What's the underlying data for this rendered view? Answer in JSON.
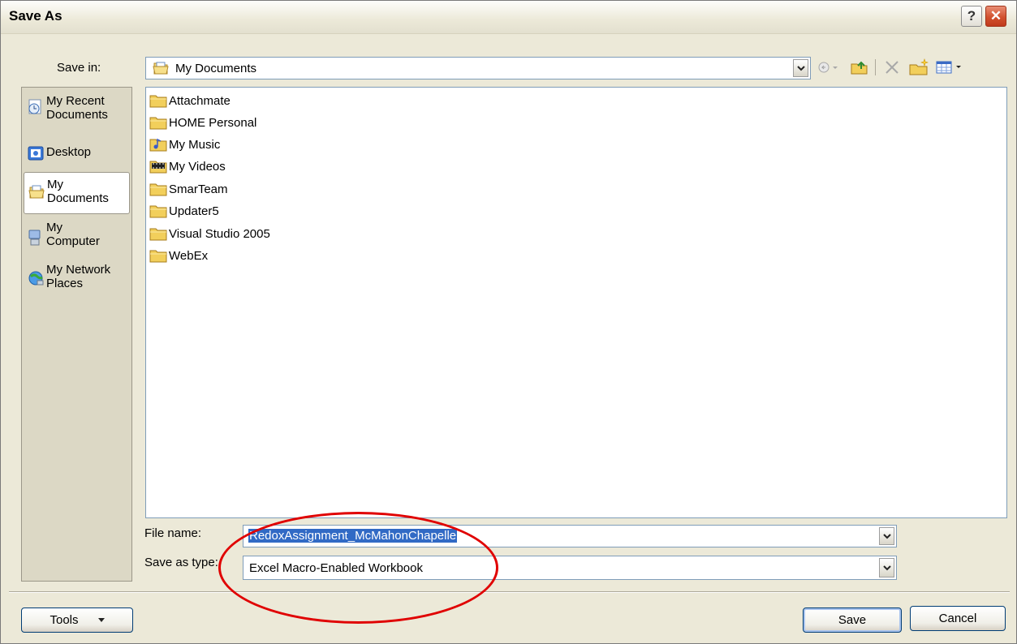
{
  "window": {
    "title": "Save As",
    "help_label": "?",
    "close_label": "✕"
  },
  "save_in": {
    "label": "Save in:",
    "value": "My Documents",
    "toolbar_icons": [
      "back-icon",
      "up-folder-icon",
      "delete-icon",
      "new-folder-icon",
      "views-icon"
    ]
  },
  "places": [
    {
      "label": "My Recent\nDocuments",
      "icon": "recent-documents-icon"
    },
    {
      "label": "Desktop",
      "icon": "desktop-icon"
    },
    {
      "label": "My\nDocuments",
      "icon": "my-documents-icon",
      "selected": true
    },
    {
      "label": "My\nComputer",
      "icon": "my-computer-icon"
    },
    {
      "label": "My Network\nPlaces",
      "icon": "network-places-icon"
    }
  ],
  "files": [
    {
      "name": "Attachmate",
      "icon": "folder-icon"
    },
    {
      "name": "HOME Personal",
      "icon": "folder-icon"
    },
    {
      "name": "My Music",
      "icon": "music-folder-icon"
    },
    {
      "name": "My Videos",
      "icon": "video-folder-icon"
    },
    {
      "name": "SmarTeam",
      "icon": "folder-icon"
    },
    {
      "name": "Updater5",
      "icon": "folder-icon"
    },
    {
      "name": "Visual Studio 2005",
      "icon": "folder-icon"
    },
    {
      "name": "WebEx",
      "icon": "folder-icon"
    }
  ],
  "file_name": {
    "label": "File name:",
    "value": "RedoxAssignment_McMahonChapelle"
  },
  "save_as_type": {
    "label": "Save as type:",
    "value": "Excel Macro-Enabled Workbook"
  },
  "buttons": {
    "tools": "Tools",
    "save": "Save",
    "cancel": "Cancel"
  },
  "colors": {
    "annotation": "#E00000",
    "selection": "#316AC5",
    "dialog_bg": "#ECE9D8"
  }
}
